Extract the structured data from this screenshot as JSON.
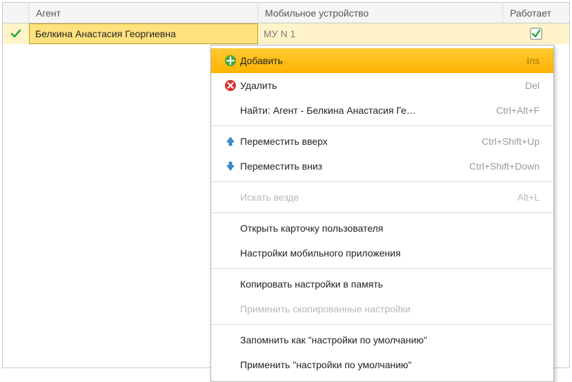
{
  "header": {
    "col_mark": "",
    "col_agent": "Агент",
    "col_device": "Мобильное устройство",
    "col_works": "Работает"
  },
  "row": {
    "agent": "Белкина Анастасия Георгиевна",
    "device": "МУ N 1",
    "works": true
  },
  "menu": {
    "items": [
      {
        "icon": "add-icon",
        "label": "Добавить",
        "shortcut": "Ins",
        "highlight": true
      },
      {
        "icon": "delete-icon",
        "label": "Удалить",
        "shortcut": "Del"
      },
      {
        "icon": "",
        "label": "Найти: Агент - Белкина Анастасия Ге…",
        "shortcut": "Ctrl+Alt+F"
      },
      {
        "sep": true
      },
      {
        "icon": "up-icon",
        "label": "Переместить вверх",
        "shortcut": "Ctrl+Shift+Up"
      },
      {
        "icon": "down-icon",
        "label": "Переместить вниз",
        "shortcut": "Ctrl+Shift+Down"
      },
      {
        "sep": true
      },
      {
        "icon": "",
        "label": "Искать везде",
        "shortcut": "Alt+L",
        "disabled": true
      },
      {
        "sep": true
      },
      {
        "icon": "",
        "label": "Открыть карточку пользователя",
        "shortcut": ""
      },
      {
        "icon": "",
        "label": "Настройки мобильного приложения",
        "shortcut": ""
      },
      {
        "sep": true
      },
      {
        "icon": "",
        "label": "Копировать настройки в память",
        "shortcut": ""
      },
      {
        "icon": "",
        "label": "Применить скопированные настройки",
        "shortcut": "",
        "disabled": true
      },
      {
        "sep": true
      },
      {
        "icon": "",
        "label": "Запомнить как \"настройки по умолчанию\"",
        "shortcut": ""
      },
      {
        "icon": "",
        "label": "Применить \"настройки по умолчанию\"",
        "shortcut": ""
      }
    ]
  }
}
